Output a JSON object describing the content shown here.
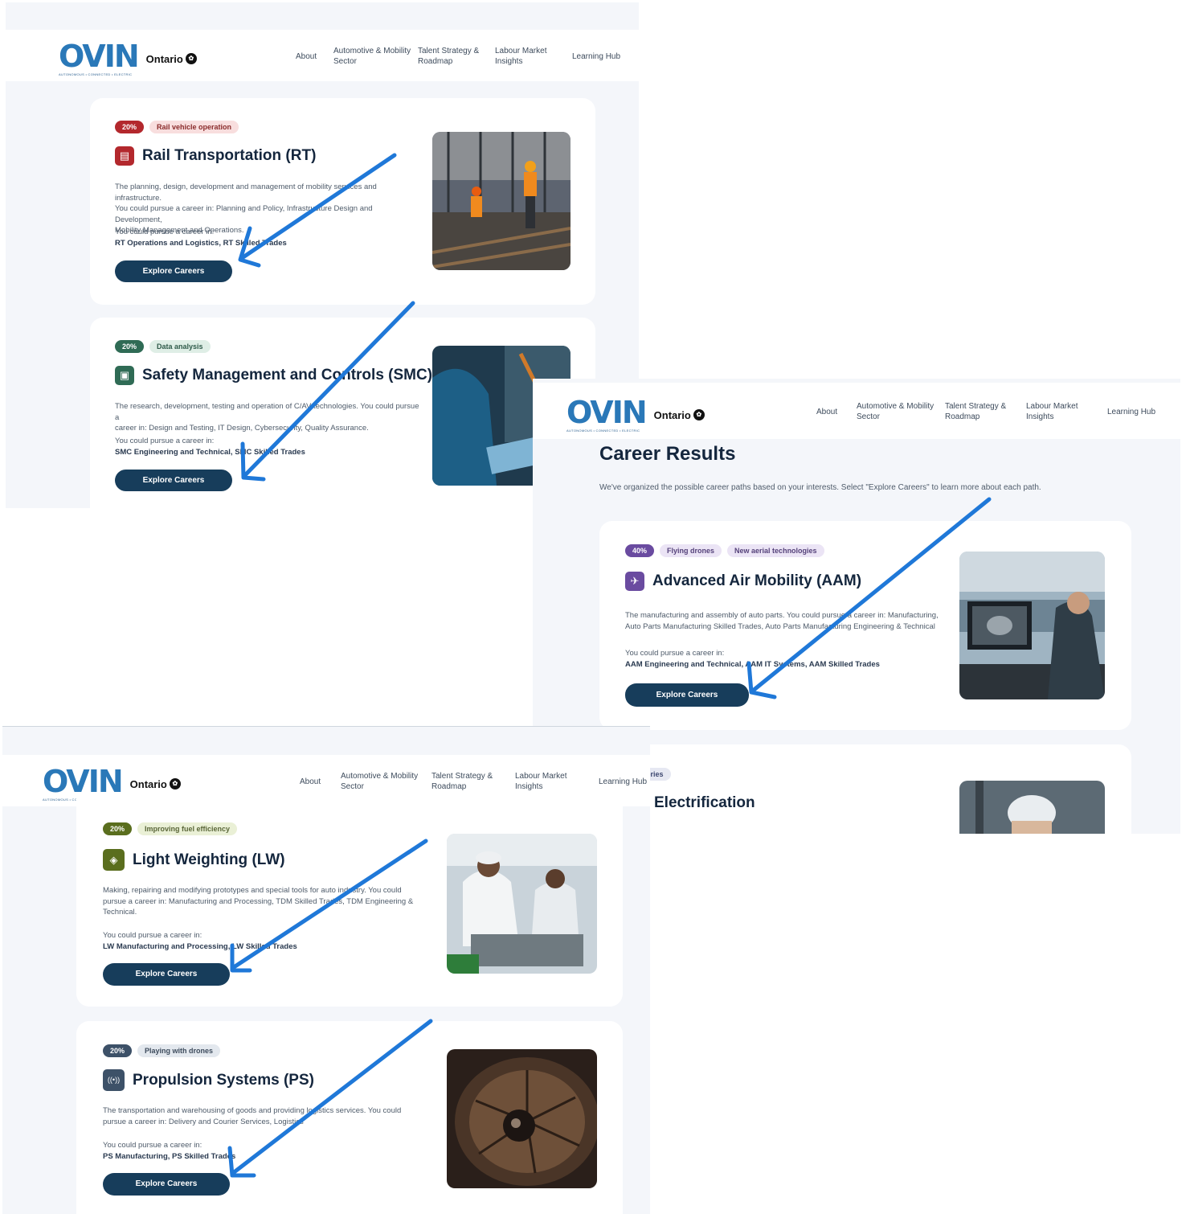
{
  "nav": {
    "logo_text": "OVIN",
    "logo_tagline": "AUTONOMOUS • CONNECTED • ELECTRIC",
    "ontario": "Ontario",
    "about": "About",
    "auto_1": "Automotive & Mobility",
    "auto_2": "Sector",
    "talent_1": "Talent Strategy &",
    "talent_2": "Roadmap",
    "labour_1": "Labour Market",
    "labour_2": "Insights",
    "learning": "Learning Hub"
  },
  "career_results": {
    "title": "Career Results",
    "intro": "We've organized the possible career paths based on your interests. Select \"Explore Careers\" to learn more about each path."
  },
  "explore_label": "Explore Careers",
  "pursue_label": "You could pursue a career in:",
  "cards": {
    "rt": {
      "percent": "20%",
      "tags": [
        "Rail vehicle operation"
      ],
      "title": "Rail Transportation (RT)",
      "desc_1": "The planning, design, development and management of mobility services and infrastructure.",
      "desc_2": "You could pursue a career in: Planning and Policy, Infrastructure Design and Development,",
      "desc_3": "Mobility Management and Operations.",
      "careers": "RT Operations and Logistics, RT Skilled Trades"
    },
    "smc": {
      "percent": "20%",
      "tags": [
        "Data analysis"
      ],
      "title": "Safety Management and Controls (SMC)",
      "desc_1": "The research, development, testing and operation of C/AV technologies. You could pursue a",
      "desc_2": "career in: Design and Testing, IT Design, Cybersecurity, Quality Assurance.",
      "careers": "SMC Engineering and Technical, SMC Skilled Trades"
    },
    "aam": {
      "percent": "40%",
      "tags": [
        "Flying drones",
        "New aerial technologies"
      ],
      "title": "Advanced Air Mobility (AAM)",
      "desc_1": "The manufacturing and assembly of auto parts. You could pursue a career in: Manufacturing,",
      "desc_2": "Auto Parts Manufacturing Skilled Trades, Auto Parts Manufacturing Engineering & Technical",
      "careers": "AAM Engineering and Technical, AAM IT Systems, AAM Skilled Trades"
    },
    "elec": {
      "tags": [
        "Batteries"
      ],
      "title": "Electrification"
    },
    "lw": {
      "percent": "20%",
      "tags": [
        "Improving fuel efficiency"
      ],
      "title": "Light Weighting (LW)",
      "desc_1": "Making, repairing and modifying prototypes and special tools for auto industry. You could",
      "desc_2": "pursue a career in: Manufacturing and Processing, TDM Skilled Trades, TDM Engineering &",
      "desc_3": "Technical.",
      "careers": "LW Manufacturing and Processing, LW Skilled Trades"
    },
    "ps": {
      "percent": "20%",
      "tags": [
        "Playing with drones"
      ],
      "title": "Propulsion Systems (PS)",
      "desc_1": "The transportation and warehousing of goods and providing logistics services. You could",
      "desc_2": "pursue a career in: Delivery and Courier Services, Logistics",
      "careers": "PS Manufacturing, PS Skilled Trades"
    }
  },
  "colors": {
    "rt": "#b3282d",
    "smc": "#2f6b55",
    "aam": "#6a4ba0",
    "lw": "#5a6e1e",
    "ps": "#3d5168",
    "button": "#173d5b",
    "arrow": "#1f78d8"
  }
}
